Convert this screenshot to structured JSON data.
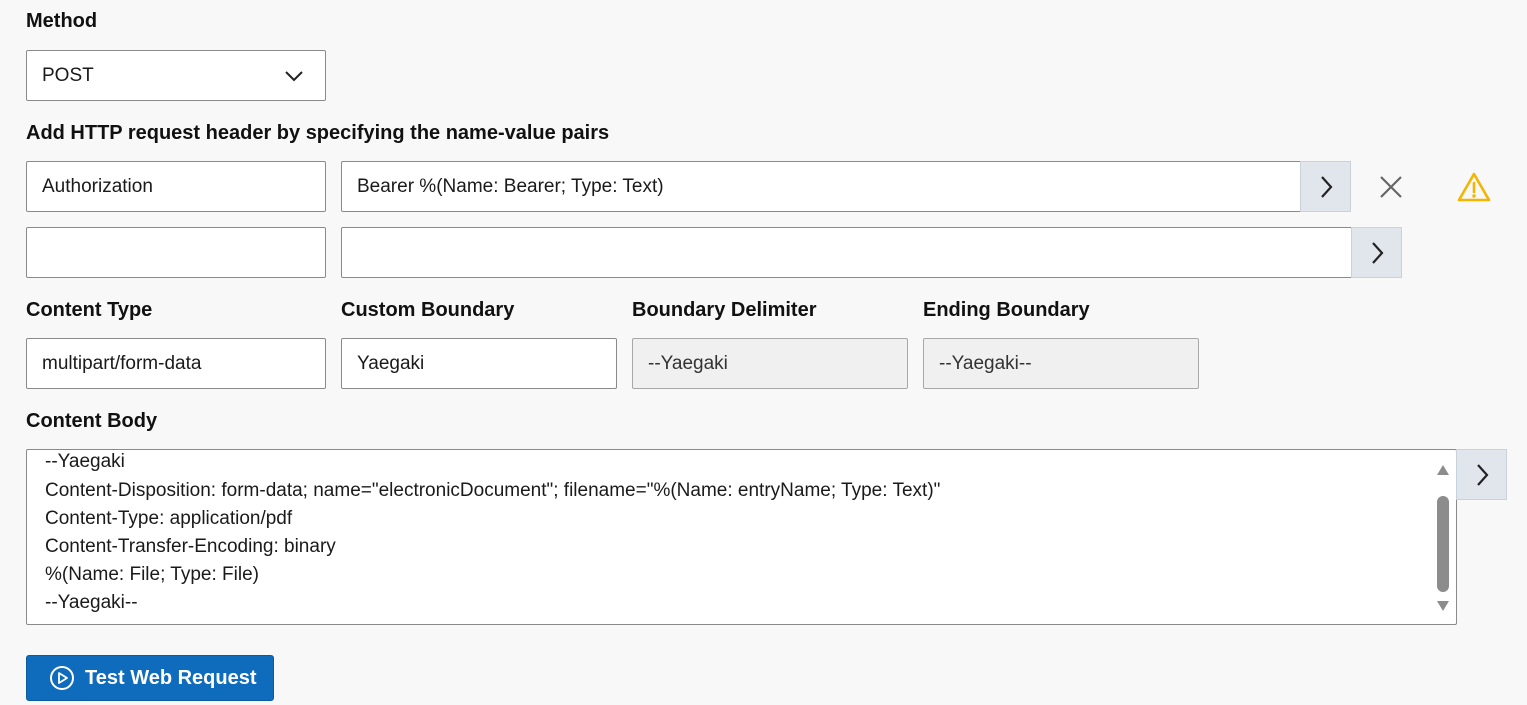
{
  "method": {
    "label": "Method",
    "selected": "POST"
  },
  "headers": {
    "label": "Add HTTP request header by specifying the name-value pairs",
    "rows": [
      {
        "name": "Authorization",
        "value": "Bearer %(Name: Bearer; Type: Text)"
      },
      {
        "name": "",
        "value": ""
      }
    ]
  },
  "content_type": {
    "label": "Content Type",
    "value": "multipart/form-data"
  },
  "custom_boundary": {
    "label": "Custom Boundary",
    "value": "Yaegaki"
  },
  "boundary_delimiter": {
    "label": "Boundary Delimiter",
    "value": "--Yaegaki"
  },
  "ending_boundary": {
    "label": "Ending Boundary",
    "value": "--Yaegaki--"
  },
  "content_body": {
    "label": "Content Body",
    "lines": [
      "--Yaegaki",
      "Content-Disposition: form-data; name=\"electronicDocument\"; filename=\"%(Name: entryName; Type: Text)\"",
      "Content-Type: application/pdf",
      "Content-Transfer-Encoding: binary",
      "%(Name: File; Type: File)",
      "--Yaegaki--"
    ]
  },
  "test_button": {
    "label": "Test Web Request"
  },
  "icons": {
    "method_dropdown": "chevron-down-icon",
    "header_expand": "chevron-right-icon",
    "header_remove": "close-icon",
    "header_warning": "warning-icon",
    "test_button": "play-circle-icon"
  },
  "colors": {
    "primary": "#0f6cbd",
    "warning": "#f2b600",
    "arrow_button_bg": "#e1e6ed"
  }
}
